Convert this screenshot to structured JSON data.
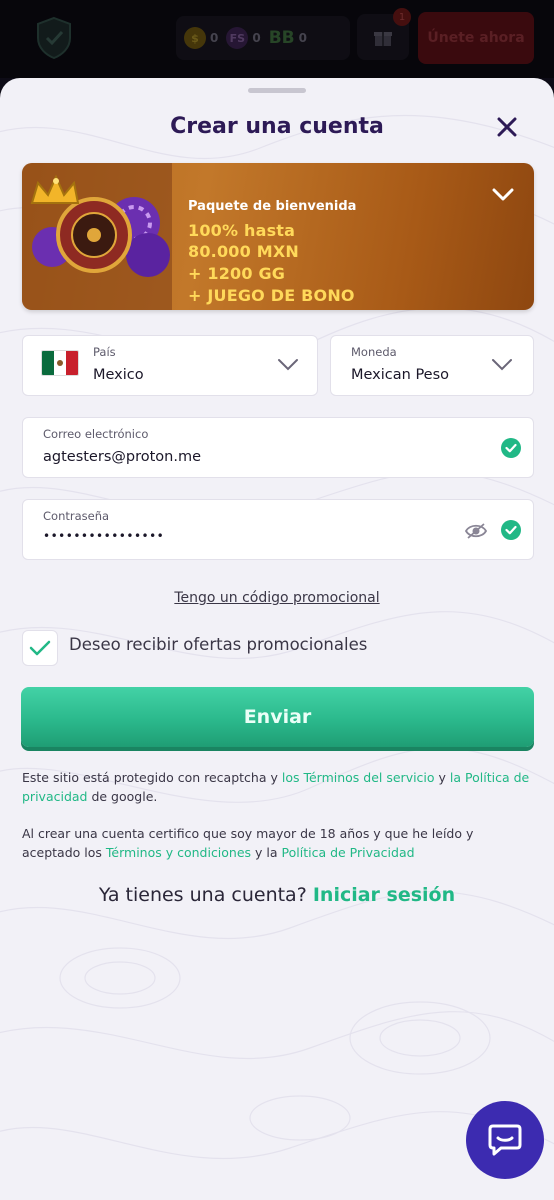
{
  "topbar": {
    "stats": [
      {
        "icon": "coin-icon",
        "value": "0"
      },
      {
        "icon": "free-spins-icon",
        "label": "FS",
        "value": "0"
      },
      {
        "icon": "bonus-buy-icon",
        "label": "BB",
        "value": "0"
      }
    ],
    "gift_badge": "1",
    "join_label": "Únete ahora"
  },
  "modal": {
    "title": "Crear una cuenta",
    "banner": {
      "subtitle": "Paquete de bienvenida",
      "lines": [
        "100% hasta",
        "80.000 MXN",
        "+ 1200 GG",
        "+ JUEGO DE BONO"
      ]
    },
    "country": {
      "label": "País",
      "value": "Mexico"
    },
    "currency": {
      "label": "Moneda",
      "value": "Mexican Peso"
    },
    "email": {
      "label": "Correo electrónico",
      "value": "agtesters@proton.me"
    },
    "password": {
      "label": "Contraseña",
      "value": "••••••••••••••••"
    },
    "promo_link": "Tengo un código promocional",
    "offers_checkbox": {
      "label": "Deseo recibir ofertas promocionales",
      "checked": true
    },
    "submit_label": "Enviar",
    "recaptcha": {
      "t1": "Este sitio está protegido con recaptcha y ",
      "l1": "los Términos del servicio",
      "t2": " y ",
      "l2": "la Política de privacidad",
      "t3": " de google."
    },
    "terms": {
      "t1": "Al crear una cuenta certifico que soy mayor de 18 años y que he leído y aceptado los ",
      "l1": "Términos y condiciones",
      "t2": " y la ",
      "l2": "Política de Privacidad"
    },
    "have_account": {
      "text": "Ya tienes una cuenta?",
      "link": "Iniciar sesión"
    }
  },
  "colors": {
    "accent": "#21b886",
    "title": "#2d1a56",
    "banner": "#c2782a",
    "chat": "#3c2bb0"
  }
}
